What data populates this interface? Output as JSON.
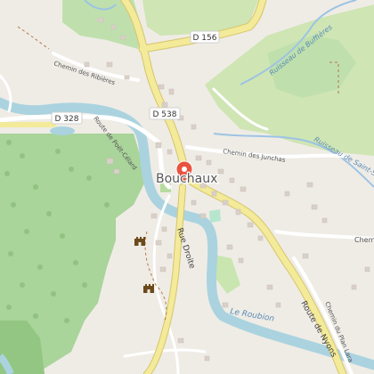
{
  "map": {
    "town_label": "Bouchaux",
    "roads": {
      "d156": "D 156",
      "d538": "D 538",
      "d328": "D 328",
      "rue_droite": "Rue Droite",
      "route_de_nyons": "Route de Nyons",
      "route_de_poet_celard": "Route de Poët-Célard",
      "chemin_des_ribieres": "Chemin des Ribières",
      "chemin_des_junchas": "Chemin des Junchas",
      "chemin_du_plan_lara": "Chemin du Plan Lara",
      "chemin_partial": "Chem"
    },
    "waterways": {
      "ruisseau_de_buffieres": "Ruisseau de Buffières",
      "ruisseau_de_saint_sauveur": "Ruisseau de Saint-Sa",
      "le_roubion": "Le Roubion"
    },
    "markers": {
      "location_pin": "location-pin-icon",
      "castle_1": "castle-icon",
      "castle_2": "castle-icon"
    },
    "colors": {
      "background": "#efece6",
      "forest": "#a9d49a",
      "forest_dark": "#92c682",
      "meadow": "#cfe5b4",
      "water": "#aad3df",
      "water_line": "#9cc3e4",
      "road_yellow": "#f3ea9a",
      "road_yellow_outline": "#d6c56a",
      "road_white": "#ffffff",
      "building": "#d9d0c9",
      "pin": "#e8533f",
      "castle": "#6b4a1b"
    }
  }
}
